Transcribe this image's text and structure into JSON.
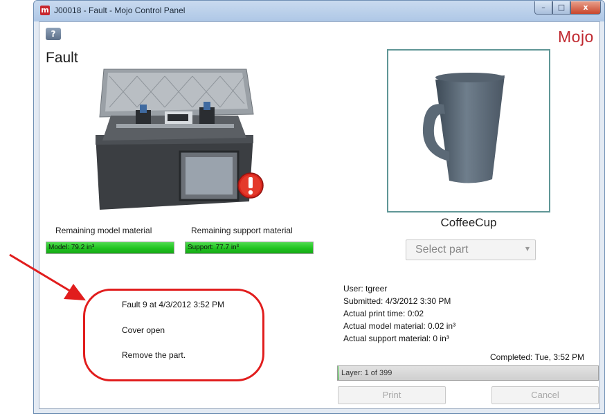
{
  "window": {
    "title": "J00018 - Fault - Mojo Control Panel",
    "app_icon_glyph": "m",
    "controls": {
      "minimize": "–",
      "maximize": "□",
      "close": "x"
    }
  },
  "header": {
    "help_icon": "help-icon",
    "help_glyph": "?",
    "logo": "Mojo",
    "status_title": "Fault"
  },
  "materials": {
    "model_label": "Remaining model material",
    "support_label": "Remaining support material",
    "model_bar_text": "Model: 79.2 in³",
    "support_bar_text": "Support: 77.7 in³",
    "model_level": 1.0,
    "support_level": 1.0
  },
  "fault": {
    "line1": "Fault 9 at 4/3/2012 3:52 PM",
    "line2": "Cover open",
    "line3": "Remove the part."
  },
  "part": {
    "name": "CoffeeCup",
    "select_placeholder": "Select part"
  },
  "job_info": {
    "user": "User: tgreer",
    "submitted": "Submitted: 4/3/2012 3:30 PM",
    "print_time": "Actual print time: 0:02",
    "model_material": "Actual model material: 0.02 in³",
    "support_material": "Actual support material: 0 in³",
    "completed": "Completed:  Tue, 3:52 PM"
  },
  "progress": {
    "layer_text": "Layer: 1 of 399",
    "fraction": 0.0025
  },
  "buttons": {
    "print": "Print",
    "cancel": "Cancel"
  },
  "colors": {
    "logo": "#c0282f",
    "annotation": "#e11d1d",
    "preview_border": "#5f9696",
    "bar_green": "#1fc21f",
    "fault_icon": "#d8261d"
  }
}
